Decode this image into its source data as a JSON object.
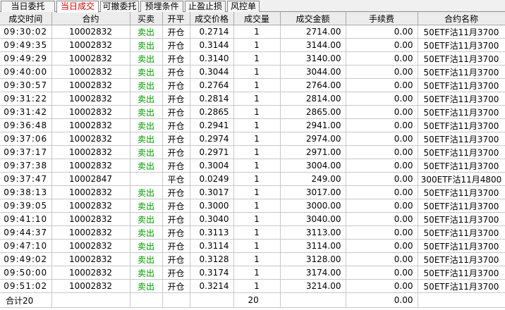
{
  "tabs": [
    {
      "label": "当日委托",
      "active": false
    },
    {
      "label": "当日成交",
      "active": true
    },
    {
      "label": "可撤委托",
      "active": false
    },
    {
      "label": "预埋条件",
      "active": false
    },
    {
      "label": "止盈止损",
      "active": false
    },
    {
      "label": "风控单",
      "active": false
    }
  ],
  "columns": [
    "成交时间",
    "合约",
    "买卖",
    "开平",
    "成交价格",
    "成交量",
    "成交金额",
    "手续费",
    "合约名称"
  ],
  "rows": [
    {
      "time": "09:30:02",
      "contract": "10002832",
      "side": "卖出",
      "oc": "开仓",
      "price": "0.2714",
      "qty": "1",
      "amount": "2714.00",
      "fee": "0.00",
      "name": "50ETF沽11月3700"
    },
    {
      "time": "09:49:35",
      "contract": "10002832",
      "side": "卖出",
      "oc": "开仓",
      "price": "0.3144",
      "qty": "1",
      "amount": "3144.00",
      "fee": "0.00",
      "name": "50ETF沽11月3700"
    },
    {
      "time": "09:49:29",
      "contract": "10002832",
      "side": "卖出",
      "oc": "开仓",
      "price": "0.3140",
      "qty": "1",
      "amount": "3140.00",
      "fee": "0.00",
      "name": "50ETF沽11月3700"
    },
    {
      "time": "09:40:00",
      "contract": "10002832",
      "side": "卖出",
      "oc": "开仓",
      "price": "0.3044",
      "qty": "1",
      "amount": "3044.00",
      "fee": "0.00",
      "name": "50ETF沽11月3700"
    },
    {
      "time": "09:30:57",
      "contract": "10002832",
      "side": "卖出",
      "oc": "开仓",
      "price": "0.2764",
      "qty": "1",
      "amount": "2764.00",
      "fee": "0.00",
      "name": "50ETF沽11月3700"
    },
    {
      "time": "09:31:22",
      "contract": "10002832",
      "side": "卖出",
      "oc": "开仓",
      "price": "0.2814",
      "qty": "1",
      "amount": "2814.00",
      "fee": "0.00",
      "name": "50ETF沽11月3700"
    },
    {
      "time": "09:31:42",
      "contract": "10002832",
      "side": "卖出",
      "oc": "开仓",
      "price": "0.2865",
      "qty": "1",
      "amount": "2865.00",
      "fee": "0.00",
      "name": "50ETF沽11月3700"
    },
    {
      "time": "09:36:48",
      "contract": "10002832",
      "side": "卖出",
      "oc": "开仓",
      "price": "0.2941",
      "qty": "1",
      "amount": "2941.00",
      "fee": "0.00",
      "name": "50ETF沽11月3700"
    },
    {
      "time": "09:37:06",
      "contract": "10002832",
      "side": "卖出",
      "oc": "开仓",
      "price": "0.2974",
      "qty": "1",
      "amount": "2974.00",
      "fee": "0.00",
      "name": "50ETF沽11月3700"
    },
    {
      "time": "09:37:17",
      "contract": "10002832",
      "side": "卖出",
      "oc": "开仓",
      "price": "0.2971",
      "qty": "1",
      "amount": "2971.00",
      "fee": "0.00",
      "name": "50ETF沽11月3700"
    },
    {
      "time": "09:37:38",
      "contract": "10002832",
      "side": "卖出",
      "oc": "开仓",
      "price": "0.3004",
      "qty": "1",
      "amount": "3004.00",
      "fee": "0.00",
      "name": "50ETF沽11月3700"
    },
    {
      "time": "09:37:47",
      "contract": "10002847",
      "side": "",
      "oc": "平仓",
      "price": "0.0249",
      "qty": "1",
      "amount": "249.00",
      "fee": "0.00",
      "name": "300ETF沽11月4800"
    },
    {
      "time": "09:38:13",
      "contract": "10002832",
      "side": "卖出",
      "oc": "开仓",
      "price": "0.3017",
      "qty": "1",
      "amount": "3017.00",
      "fee": "0.00",
      "name": "50ETF沽11月3700"
    },
    {
      "time": "09:39:05",
      "contract": "10002832",
      "side": "卖出",
      "oc": "开仓",
      "price": "0.3000",
      "qty": "1",
      "amount": "3000.00",
      "fee": "0.00",
      "name": "50ETF沽11月3700"
    },
    {
      "time": "09:41:10",
      "contract": "10002832",
      "side": "卖出",
      "oc": "开仓",
      "price": "0.3040",
      "qty": "1",
      "amount": "3040.00",
      "fee": "0.00",
      "name": "50ETF沽11月3700"
    },
    {
      "time": "09:44:37",
      "contract": "10002832",
      "side": "卖出",
      "oc": "开仓",
      "price": "0.3113",
      "qty": "1",
      "amount": "3113.00",
      "fee": "0.00",
      "name": "50ETF沽11月3700"
    },
    {
      "time": "09:47:10",
      "contract": "10002832",
      "side": "卖出",
      "oc": "开仓",
      "price": "0.3114",
      "qty": "1",
      "amount": "3114.00",
      "fee": "0.00",
      "name": "50ETF沽11月3700"
    },
    {
      "time": "09:49:02",
      "contract": "10002832",
      "side": "卖出",
      "oc": "开仓",
      "price": "0.3128",
      "qty": "1",
      "amount": "3128.00",
      "fee": "0.00",
      "name": "50ETF沽11月3700"
    },
    {
      "time": "09:50:00",
      "contract": "10002832",
      "side": "卖出",
      "oc": "开仓",
      "price": "0.3174",
      "qty": "1",
      "amount": "3174.00",
      "fee": "0.00",
      "name": "50ETF沽11月3700"
    },
    {
      "time": "09:51:02",
      "contract": "10002832",
      "side": "卖出",
      "oc": "开仓",
      "price": "0.3214",
      "qty": "1",
      "amount": "3214.00",
      "fee": "0.00",
      "name": "50ETF沽11月3700"
    }
  ],
  "totals": {
    "label": "合计20",
    "qty": "20",
    "fee": "0.00"
  },
  "colors": {
    "active_tab_text": "#d40000",
    "sell_text": "#009900",
    "header_bg": "#ececec"
  }
}
